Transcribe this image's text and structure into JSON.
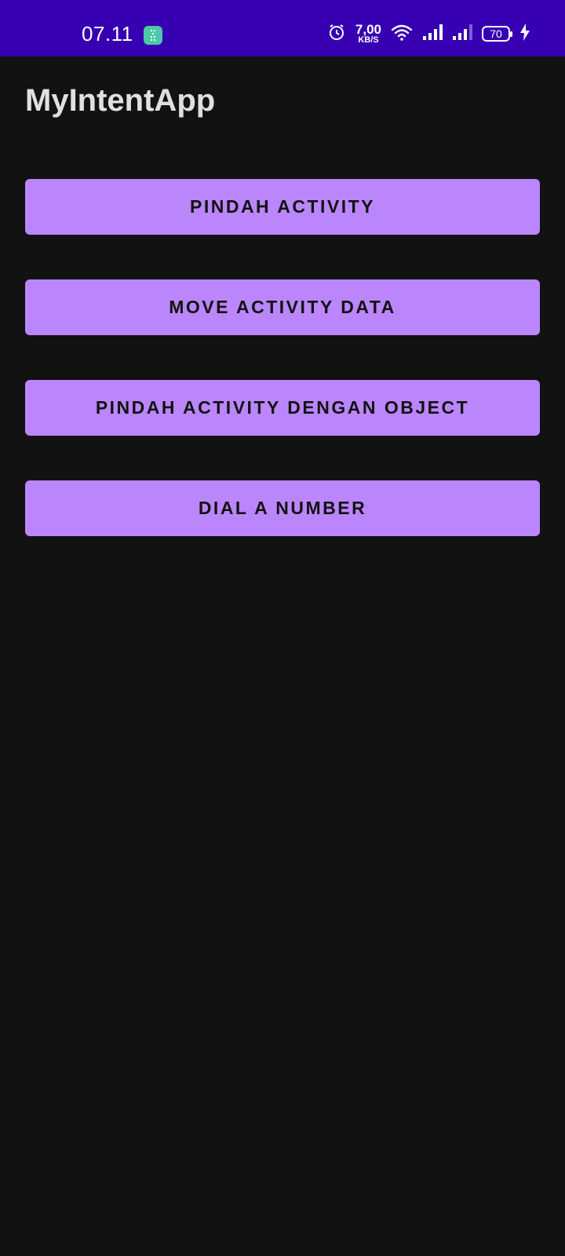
{
  "status_bar": {
    "time": "07.11",
    "net_speed_value": "7,00",
    "net_speed_unit": "KB/S",
    "battery_level": "70",
    "icons": [
      "app-notification-icon",
      "alarm-icon",
      "wifi-icon",
      "signal-icon",
      "signal-icon",
      "battery-icon",
      "charging-icon"
    ],
    "background_color": "#3700b3"
  },
  "app": {
    "title": "MyIntentApp"
  },
  "buttons": [
    {
      "label": "PINDAH ACTIVITY"
    },
    {
      "label": "MOVE ACTIVITY DATA"
    },
    {
      "label": "PINDAH ACTIVITY DENGAN OBJECT"
    },
    {
      "label": "DIAL A NUMBER"
    }
  ],
  "colors": {
    "background": "#121212",
    "button": "#bb86fc",
    "button_text": "#121212",
    "title_text": "#e0e0e0"
  }
}
